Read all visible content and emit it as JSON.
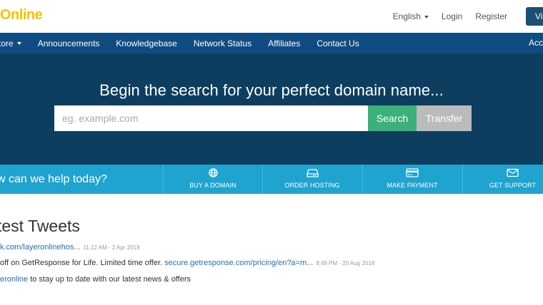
{
  "header": {
    "logo_text": "Online",
    "language": "English",
    "login": "Login",
    "register": "Register",
    "cart_button": "Vi"
  },
  "nav": {
    "items": [
      "tore",
      "Announcements",
      "Knowledgebase",
      "Network Status",
      "Affiliates",
      "Contact Us"
    ],
    "right_item": "Acc"
  },
  "hero": {
    "title": "Begin the search for your perfect domain name...",
    "search_placeholder": "eg. example.com",
    "search_button": "Search",
    "transfer_button": "Transfer"
  },
  "help": {
    "prompt": "w can we help today?",
    "actions": [
      {
        "label": "BUY A DOMAIN",
        "icon": "globe-icon"
      },
      {
        "label": "ORDER HOSTING",
        "icon": "hard-drive-icon"
      },
      {
        "label": "MAKE PAYMENT",
        "icon": "credit-card-icon"
      },
      {
        "label": "GET SUPPORT",
        "icon": "envelope-icon"
      }
    ]
  },
  "tweets": {
    "title": "test Tweets",
    "items": [
      {
        "prefix": "",
        "link": "k.com/layeronlinehos...",
        "suffix": "",
        "time": "11:12 AM - 2 Apr 2019"
      },
      {
        "prefix": "off on GetResponse for Life. Limited time offer. ",
        "link": "secure.getresponse.com/pricing/en?a=m...",
        "suffix": "",
        "time": "8:49 PM - 20 Aug 2018"
      },
      {
        "prefix": "",
        "link": "eronline",
        "suffix": " to stay up to date with our latest news & offers",
        "time": ""
      }
    ]
  },
  "colors": {
    "nav": "#0f4c81",
    "hero": "#0d3e5f",
    "help": "#1fa3cf",
    "search_btn": "#3bb07b",
    "transfer_btn": "#bbbbbb",
    "logo": "#f4c300"
  }
}
